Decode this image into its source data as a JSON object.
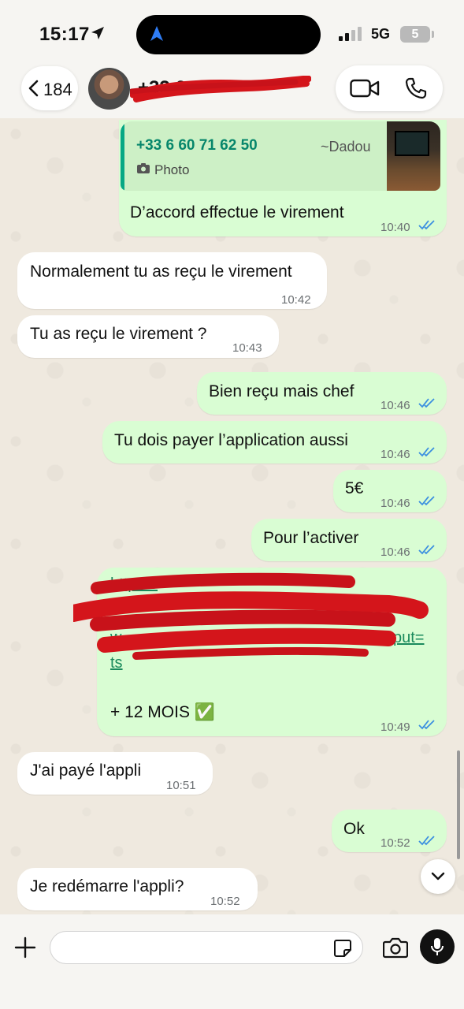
{
  "status_bar": {
    "time": "15:17",
    "network": "5G",
    "battery": "5"
  },
  "header": {
    "back_count": "184",
    "contact_name": "+33 6"
  },
  "quote": {
    "number": "+33 6 60 71 62 50",
    "alias": "~Dadou",
    "type": "Photo"
  },
  "messages": [
    {
      "dir": "out",
      "text": "D’accord effectue le virement",
      "time": "10:40"
    },
    {
      "dir": "in",
      "text": "Normalement tu as reçu le virement",
      "time": "10:42"
    },
    {
      "dir": "in",
      "text": "Tu as reçu le virement ?",
      "time": "10:43"
    },
    {
      "dir": "out",
      "text": "Bien reçu mais chef",
      "time": "10:46"
    },
    {
      "dir": "out",
      "text": "Tu dois payer l’application aussi",
      "time": "10:46"
    },
    {
      "dir": "out",
      "text": "5€",
      "time": "10:46"
    },
    {
      "dir": "out",
      "text": "Pour l’activer",
      "time": "10:46"
    },
    {
      "dir": "out",
      "link_line1": "https://",
      "link_line2": "w",
      "link_line3": "put=",
      "link_line4": "ts",
      "text": "+ 12 MOIS ✅",
      "time": "10:49"
    },
    {
      "dir": "in",
      "text": "J'ai payé l'appli",
      "time": "10:51"
    },
    {
      "dir": "out",
      "text": "Ok",
      "time": "10:52"
    },
    {
      "dir": "in",
      "text": "Je redémarre l'appli?",
      "time": "10:52"
    }
  ],
  "input": {
    "value": "",
    "placeholder": ""
  },
  "colors": {
    "outgoing": "#d9fdd3",
    "incoming": "#ffffff",
    "accent": "#06a884",
    "read_ticks": "#3b8fe0"
  }
}
